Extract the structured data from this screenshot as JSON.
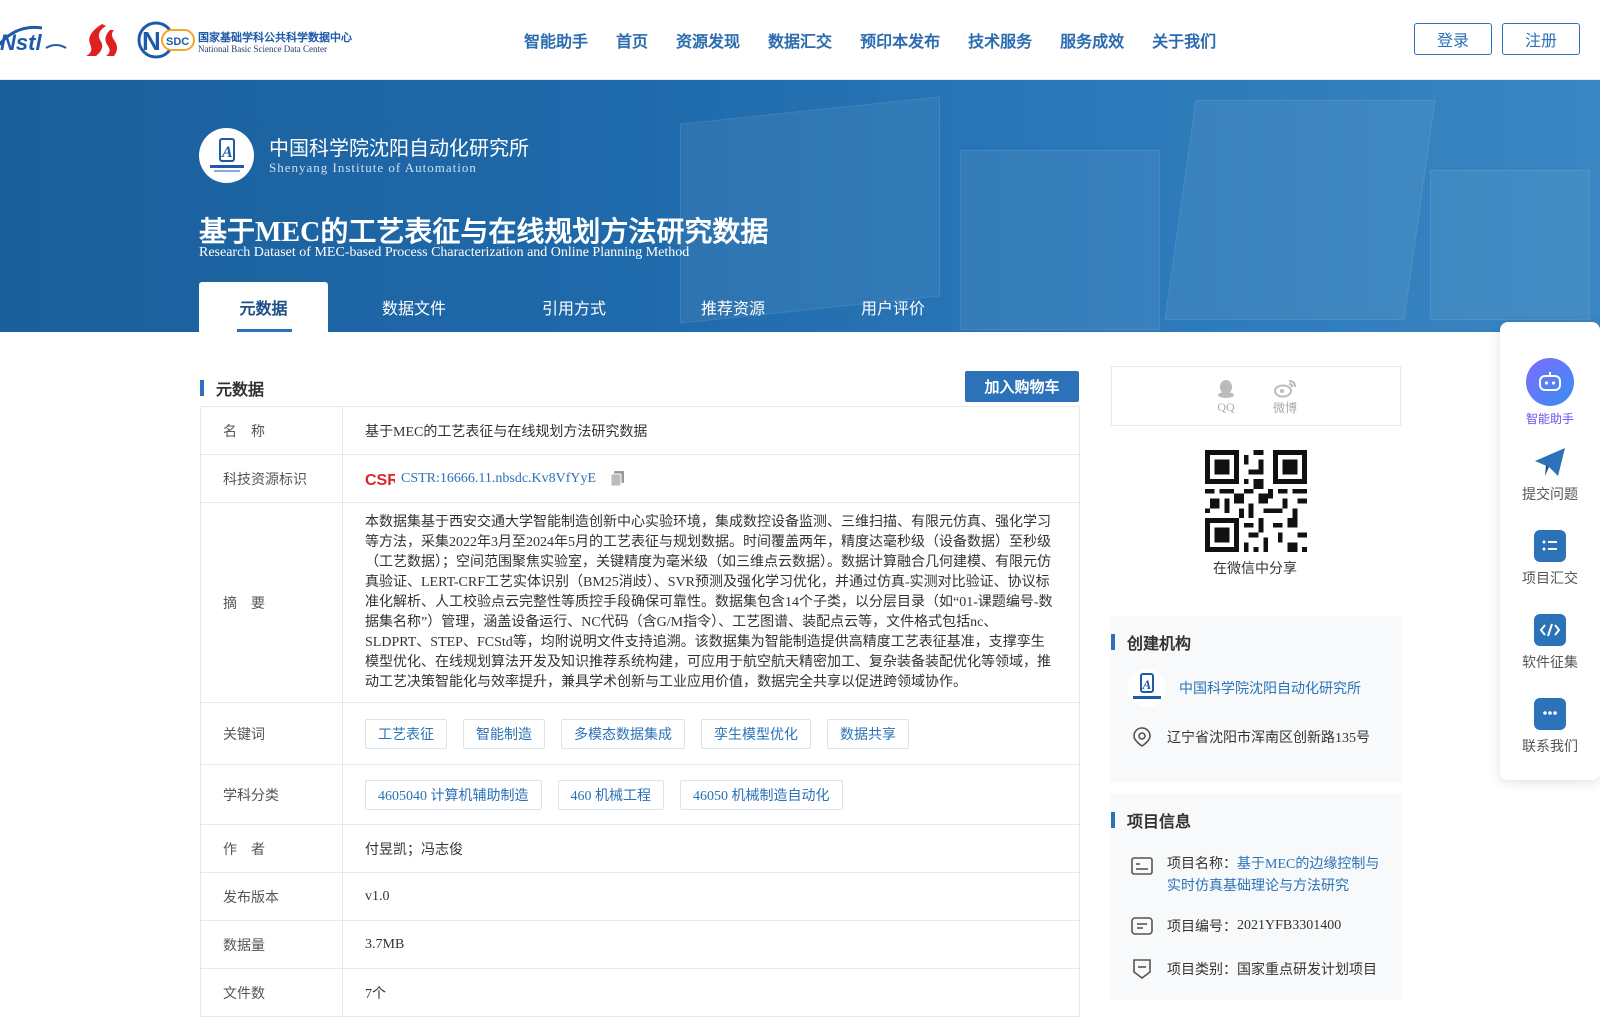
{
  "header": {
    "logo_nsdc_cn": "国家基础学科公共科学数据中心",
    "logo_nsdc_en": "National Basic Science Data Center",
    "nav": [
      "智能助手",
      "首页",
      "资源发现",
      "数据汇交",
      "预印本发布",
      "技术服务",
      "服务成效",
      "关于我们"
    ],
    "login": "登录",
    "register": "注册"
  },
  "banner": {
    "institution_cn": "中国科学院沈阳自动化研究所",
    "institution_en": "Shenyang Institute of Automation",
    "title": "基于MEC的工艺表征与在线规划方法研究数据",
    "subtitle": "Research Dataset of MEC-based Process Characterization and Online Planning Method",
    "tabs": [
      "元数据",
      "数据文件",
      "引用方式",
      "推荐资源",
      "用户评价"
    ]
  },
  "metadata": {
    "section_title": "元数据",
    "cart_button": "加入购物车",
    "rows": {
      "name_label": "名　称",
      "name_value": "基于MEC的工艺表征与在线规划方法研究数据",
      "id_label": "科技资源标识",
      "id_value": "CSTR:16666.11.nbsdc.Kv8VfYyE",
      "abstract_label": "摘　要",
      "abstract_value": "本数据集基于西安交通大学智能制造创新中心实验环境，集成数控设备监测、三维扫描、有限元仿真、强化学习等方法，采集2022年3月至2024年5月的工艺表征与规划数据。时间覆盖两年，精度达毫秒级（设备数据）至秒级（工艺数据）；空间范围聚焦实验室，关键精度为毫米级（如三维点云数据）。数据计算融合几何建模、有限元仿真验证、LERT-CRF工艺实体识别（BM25消歧）、SVR预测及强化学习优化，并通过仿真-实测对比验证、协议标准化解析、人工校验点云完整性等质控手段确保可靠性。数据集包含14个子类，以分层目录（如“01-课题编号-数据集名称”）管理，涵盖设备运行、NC代码（含G/M指令）、工艺图谱、装配点云等，文件格式包括nc、SLDPRT、STEP、FCStd等，均附说明文件支持追溯。该数据集为智能制造提供高精度工艺表征基准，支撑孪生模型优化、在线规划算法开发及知识推荐系统构建，可应用于航空航天精密加工、复杂装备装配优化等领域，推动工艺决策智能化与效率提升，兼具学术创新与工业应用价值，数据完全共享以促进跨领域协作。",
      "keywords_label": "关键词",
      "keywords": [
        "工艺表征",
        "智能制造",
        "多模态数据集成",
        "孪生模型优化",
        "数据共享"
      ],
      "subject_label": "学科分类",
      "subjects": [
        "4605040 计算机辅助制造",
        "460 机械工程",
        "46050 机械制造自动化"
      ],
      "author_label": "作　者",
      "author_value": "付昱凯；冯志俊",
      "version_label": "发布版本",
      "version_value": "v1.0",
      "size_label": "数据量",
      "size_value": "3.7MB",
      "files_label": "文件数",
      "files_value": "7个"
    }
  },
  "share": {
    "qq": "QQ",
    "weibo": "微博",
    "wechat_caption": "在微信中分享"
  },
  "creator": {
    "title": "创建机构",
    "institution": "中国科学院沈阳自动化研究所",
    "address": "辽宁省沈阳市浑南区创新路135号"
  },
  "project": {
    "title": "项目信息",
    "name_label": "项目名称：",
    "name_value": "基于MEC的边缘控制与实时仿真基础理论与方法研究",
    "code_label": "项目编号：",
    "code_value": "2021YFB3301400",
    "type_label": "项目类别：",
    "type_value": "国家重点研发计划项目"
  },
  "float_panel": [
    "智能助手",
    "提交问题",
    "项目汇交",
    "软件征集",
    "联系我们"
  ],
  "colors": {
    "primary": "#2b72b8",
    "banner": "#1f6aab",
    "assistant": "#6b4ef0"
  }
}
